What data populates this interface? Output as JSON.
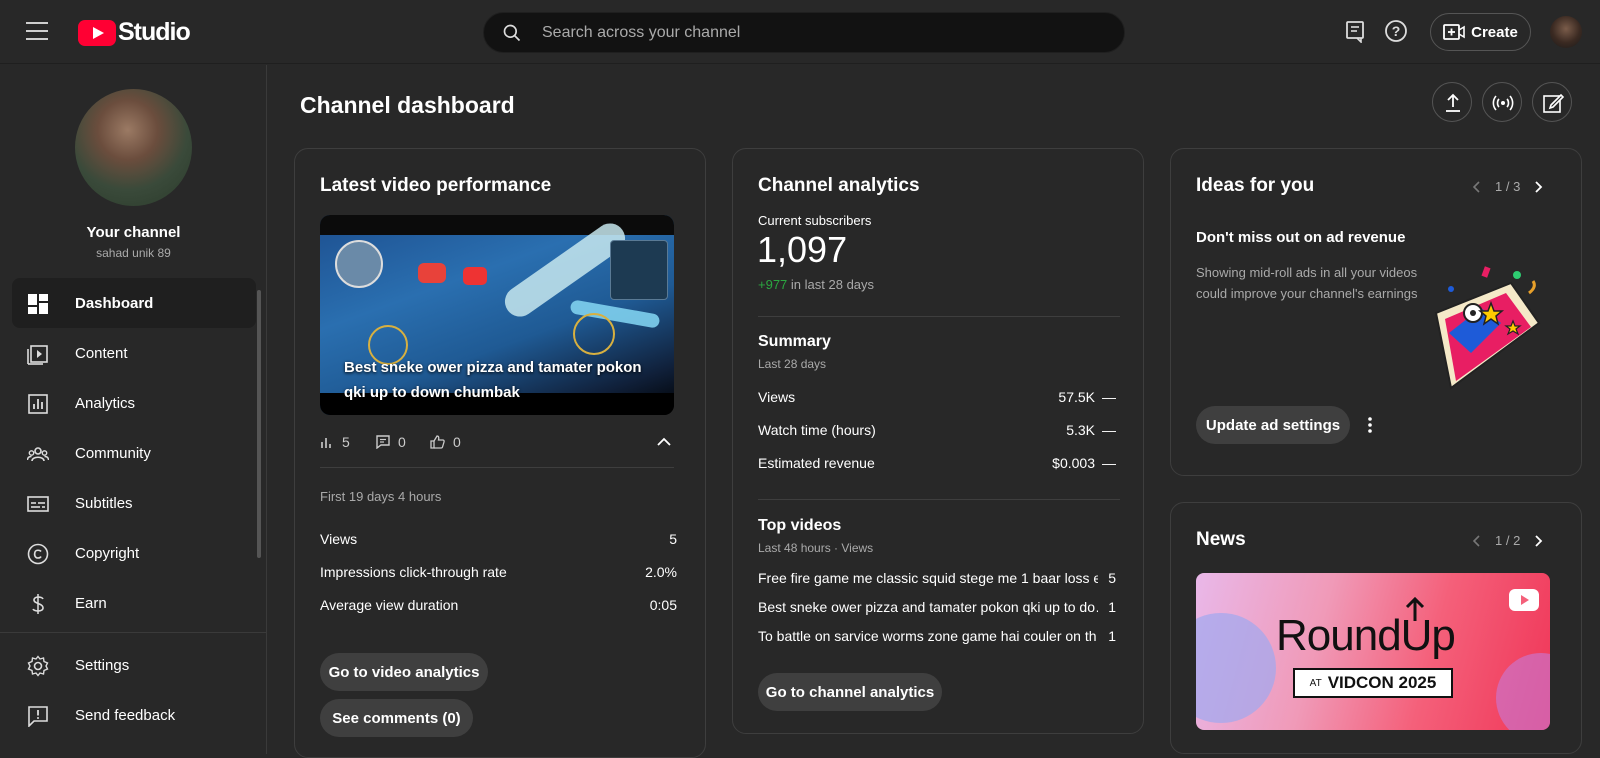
{
  "app": {
    "logo_text": "Studio",
    "brand_color": "#ff0033"
  },
  "search": {
    "placeholder": "Search across your channel"
  },
  "header": {
    "create_label": "Create"
  },
  "sidebar": {
    "channel_title": "Your channel",
    "channel_handle": "sahad unik 89",
    "items": [
      {
        "label": "Dashboard",
        "icon": "dashboard-icon",
        "active": true
      },
      {
        "label": "Content",
        "icon": "content-icon"
      },
      {
        "label": "Analytics",
        "icon": "analytics-icon"
      },
      {
        "label": "Community",
        "icon": "community-icon"
      },
      {
        "label": "Subtitles",
        "icon": "subtitles-icon"
      },
      {
        "label": "Copyright",
        "icon": "copyright-icon"
      },
      {
        "label": "Earn",
        "icon": "earn-icon"
      }
    ],
    "bottom_items": [
      {
        "label": "Settings",
        "icon": "gear-icon"
      },
      {
        "label": "Send feedback",
        "icon": "feedback-icon"
      }
    ]
  },
  "main": {
    "title": "Channel dashboard"
  },
  "latest_video": {
    "title": "Latest video performance",
    "video_title": "Best sneke ower pizza and tamater pokon qki up to down chumbak",
    "views_count": "5",
    "comments_count": "0",
    "likes_count": "0",
    "period": "First 19 days 4 hours",
    "metrics": [
      {
        "label": "Views",
        "value": "5"
      },
      {
        "label": "Impressions click-through rate",
        "value": "2.0%"
      },
      {
        "label": "Average view duration",
        "value": "0:05"
      }
    ],
    "go_analytics_label": "Go to video analytics",
    "comments_label": "See comments (0)"
  },
  "channel_analytics": {
    "title": "Channel analytics",
    "subscribers_label": "Current subscribers",
    "subscribers_count": "1,097",
    "subscribers_delta": "+977",
    "subscribers_delta_suffix": "in last 28 days",
    "summary_title": "Summary",
    "summary_period": "Last 28 days",
    "summary": [
      {
        "label": "Views",
        "value": "57.5K",
        "trend": "—"
      },
      {
        "label": "Watch time (hours)",
        "value": "5.3K",
        "trend": "—"
      },
      {
        "label": "Estimated revenue",
        "value": "$0.003",
        "trend": "—"
      }
    ],
    "top_title": "Top videos",
    "top_period": "Last 48 hours · Views",
    "top_videos": [
      {
        "title": "Free fire game me classic squid stege me 1 baar loss e…",
        "views": "5"
      },
      {
        "title": "Best sneke ower pizza and tamater pokon qki up to do…",
        "views": "1"
      },
      {
        "title": "To battle on sarvice worms zone game hai couler on th…",
        "views": "1"
      }
    ],
    "button_label": "Go to channel analytics"
  },
  "ideas": {
    "title": "Ideas for you",
    "pager": "1 / 3",
    "headline": "Don't miss out on ad revenue",
    "body": "Showing mid-roll ads in all your videos could improve your channel's earnings",
    "button_label": "Update ad settings"
  },
  "news": {
    "title": "News",
    "pager": "1 / 2",
    "banner_title": "RoundUp",
    "banner_at": "AT",
    "banner_event": "VIDCON 2025"
  }
}
